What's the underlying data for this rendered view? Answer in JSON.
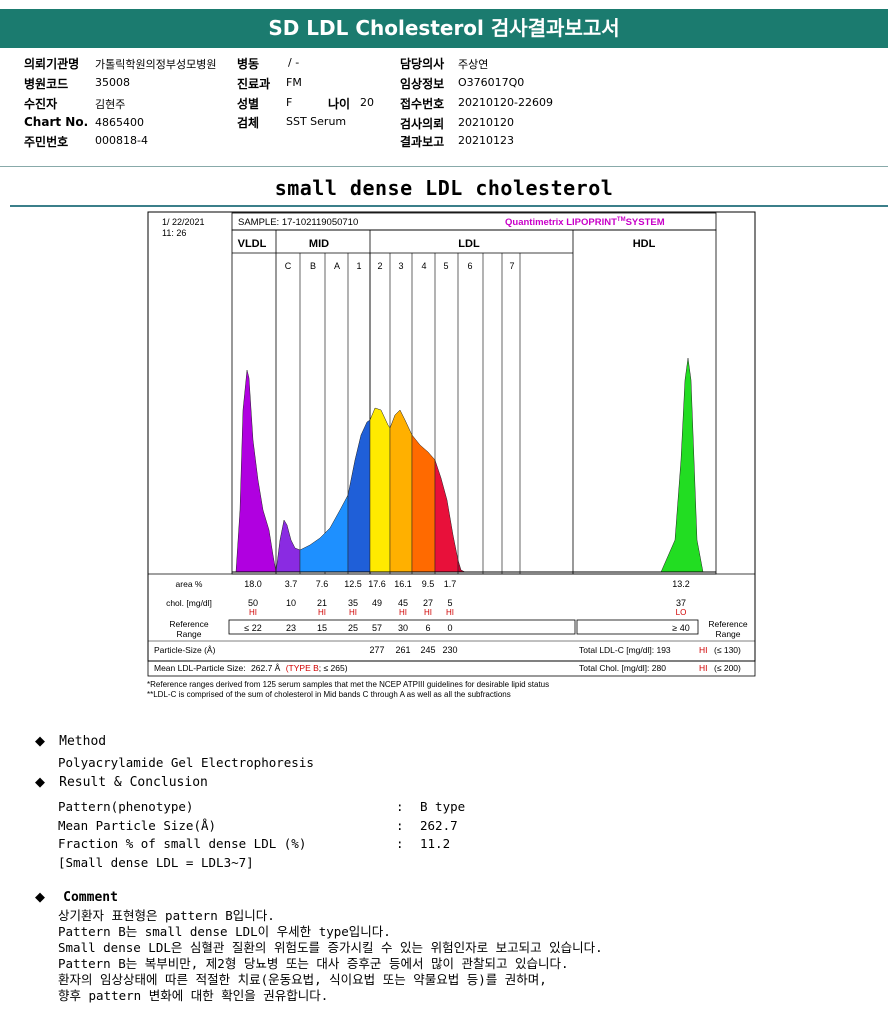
{
  "title": "SD LDL Cholesterol 검사결과보고서",
  "header": {
    "col1": [
      {
        "label": "의뢰기관명",
        "value": "가톨릭학원의정부성모병원"
      },
      {
        "label": "병원코드",
        "value": "35008"
      },
      {
        "label": "수진자",
        "value": "김현주"
      },
      {
        "label": "Chart No.",
        "value": "4865400"
      },
      {
        "label": "주민번호",
        "value": "000818-4"
      }
    ],
    "col2": [
      {
        "label": "병동",
        "value": "/ -"
      },
      {
        "label": "진료과",
        "value": "FM"
      },
      {
        "label": "성별",
        "value": "F"
      },
      {
        "label": "검체",
        "value": "SST Serum"
      }
    ],
    "age_label": "나이",
    "age_value": "20",
    "col3": [
      {
        "label": "담당의사",
        "value": "주상연"
      },
      {
        "label": "임상정보",
        "value": "O376017Q0"
      },
      {
        "label": "접수번호",
        "value": "20210120-22609"
      },
      {
        "label": "검사의뢰",
        "value": "20210120"
      },
      {
        "label": "결과보고",
        "value": "20210123"
      }
    ]
  },
  "section_title": "small dense LDL cholesterol",
  "report": {
    "date": "1/ 22/2021",
    "time": "11: 26",
    "sample": "SAMPLE:   17-102119050710",
    "brand": "Quantimetrix LIPOPRINT",
    "brand_tm": "TM",
    "brand_sys": "SYSTEM",
    "groups": [
      "VLDL",
      "MID",
      "LDL",
      "HDL"
    ],
    "bands": [
      "C",
      "B",
      "A",
      "1",
      "2",
      "3",
      "4",
      "5",
      "6",
      "7"
    ],
    "row_labels": {
      "area": "area %",
      "chol": "chol. [mg/dl]",
      "ref1": "Reference",
      "ref2": "Range",
      "ref_right1": "Reference",
      "ref_right2": "Range",
      "psize": "Particle-Size (Å)",
      "mean": "Mean LDL-Particle Size:"
    },
    "area": [
      "18.0",
      "3.7",
      "7.6",
      "12.5",
      "17.6",
      "16.1",
      "9.5",
      "1.7",
      "13.2"
    ],
    "chol": [
      "50",
      "10",
      "21",
      "35",
      "49",
      "45",
      "27",
      "5",
      "37"
    ],
    "chol_flags": [
      "HI",
      "",
      "HI",
      "HI",
      "",
      "HI",
      "HI",
      "HI",
      "LO"
    ],
    "ref": [
      "≤ 22",
      "23",
      "15",
      "25",
      "57",
      "30",
      "6",
      "0",
      "≥ 40"
    ],
    "psize": [
      "277",
      "261",
      "245",
      "230"
    ],
    "mean_value": "262.7 Å",
    "mean_type": "(TYPE B",
    "mean_ref": "; ≤ 265)",
    "total_ldl": "Total LDL-C [mg/dl]:  193",
    "total_ldl_flag": "HI",
    "total_ldl_ref": "(≤ 130)",
    "total_chol": "Total Chol. [mg/dl]:   280",
    "total_chol_flag": "HI",
    "total_chol_ref": "(≤ 200)",
    "footnote1": "*Reference ranges derived from 125 serum samples that met the NCEP ATPIII guidelines for desirable lipid status",
    "footnote2": "**LDL-C is comprised of the sum of cholesterol in Mid bands C through A as well as all the subfractions"
  },
  "method": {
    "heading": "Method",
    "text": "Polyacrylamide Gel Electrophoresis"
  },
  "result": {
    "heading": "Result & Conclusion",
    "rows": [
      {
        "label": "Pattern(phenotype)",
        "sep": ":",
        "value": "B type"
      },
      {
        "label": "Mean Particle Size(Å)",
        "sep": ":",
        "value": "262.7"
      },
      {
        "label": "Fraction % of small dense LDL (%)",
        "sep": ":",
        "value": "11.2"
      }
    ],
    "note": "[Small dense LDL = LDL3~7]"
  },
  "comment": {
    "heading": "Comment",
    "lines": [
      "상기환자 표현형은 pattern B입니다.",
      "Pattern B는 small dense LDL이 우세한 type입니다.",
      "Small dense LDL은 심혈관 질환의 위험도를 증가시킬 수 있는 위험인자로 보고되고 있습니다.",
      "Pattern B는 복부비만, 제2형 당뇨병 또는 대사 증후군 등에서 많이 관찰되고 있습니다.",
      "환자의 임상상태에 따른 적절한 치료(운동요법, 식이요법 또는 약물요법 등)를 권하며,",
      "향후 pattern 변화에 대한 확인을 권유합니다."
    ]
  },
  "colors": {
    "banner": "#1b7b6f",
    "vldl": "#b000e0",
    "mid_c": "#8a2be2",
    "mid_b": "#1e90ff",
    "mid_a": "#1f5fd8",
    "ldl1": "#ffea00",
    "ldl2": "#ffb000",
    "ldl3": "#ff6a00",
    "ldl4": "#e8103a",
    "hdl": "#22dd22",
    "hi": "#d00000"
  }
}
